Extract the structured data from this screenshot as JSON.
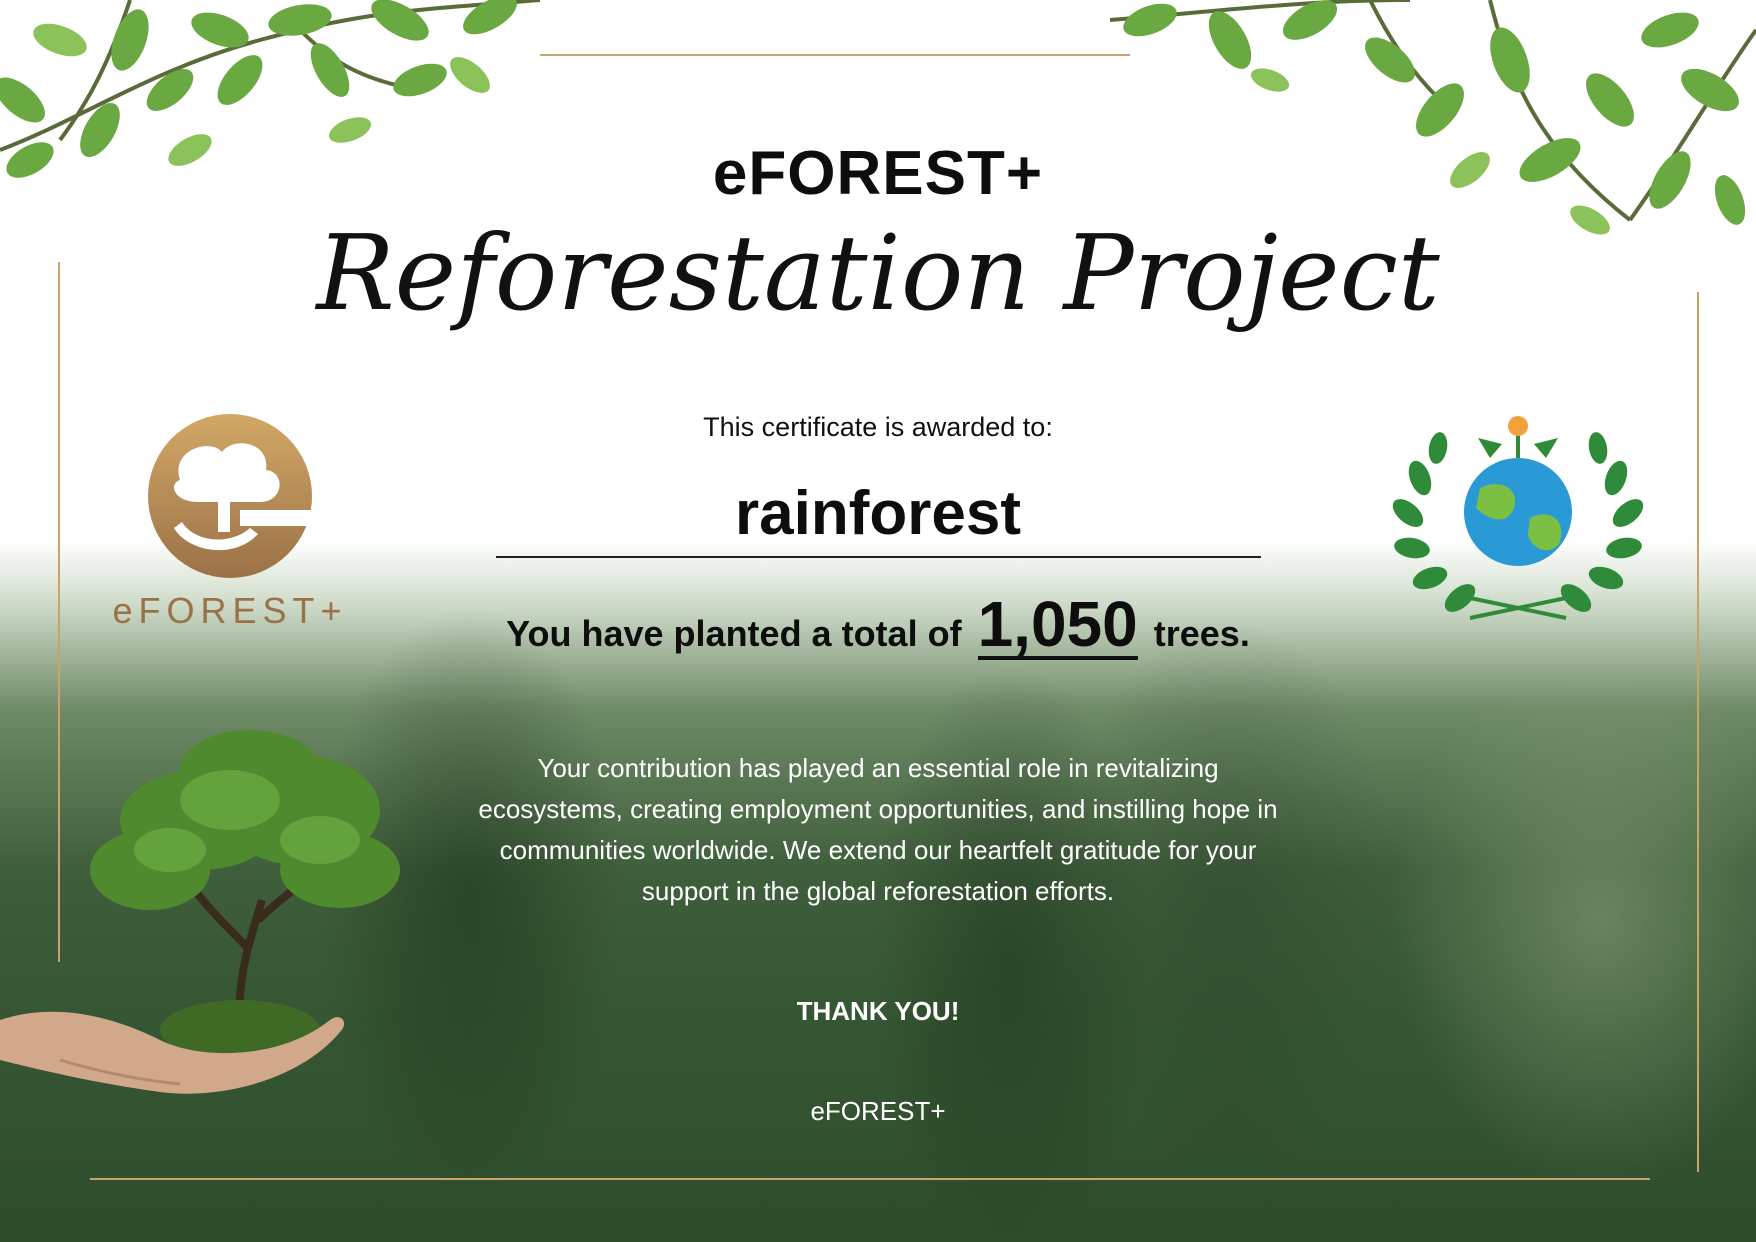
{
  "certificate": {
    "brand": "eFOREST+",
    "title": "Reforestation Project",
    "awarded_label": "This certificate is awarded to:",
    "recipient": "rainforest",
    "planted_prefix": "You have planted a total of",
    "tree_count": "1,050",
    "planted_suffix": "trees.",
    "message": "Your contribution has played an essential role in revitalizing ecosystems, creating employment opportunities, and instilling hope in communities worldwide. We extend our heartfelt gratitude for your support in the global reforestation efforts.",
    "thanks": "THANK YOU!",
    "signoff": "eFOREST+"
  },
  "logo": {
    "wordmark": "eFOREST+",
    "icon": "tree-e-logo-icon"
  },
  "emblem": {
    "icon": "earth-laurel-wreath-icon"
  },
  "illustrations": {
    "leaves": "leaf-branches-icon",
    "tree_in_hand": "tree-in-hand-icon"
  },
  "colors": {
    "gold": "#c7a36e",
    "logo_brown": "#9b7148",
    "leaf_green": "#6aa842",
    "forest_dark": "#2f4d2c",
    "text_dark": "#0d0d0d",
    "text_light": "#ffffff"
  }
}
